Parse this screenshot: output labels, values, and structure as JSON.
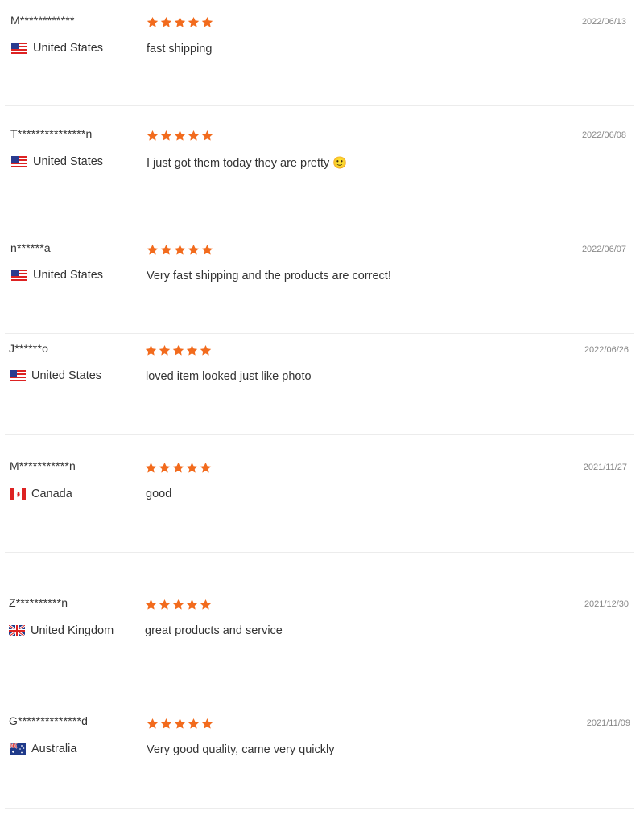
{
  "reviews": [
    {
      "name": "M************",
      "country": "United States",
      "flag": "us",
      "rating": 5,
      "text": "fast shipping",
      "date": "2022/06/13"
    },
    {
      "name": "T***************n",
      "country": "United States",
      "flag": "us",
      "rating": 5,
      "text": "I just got them today they are pretty 🙂",
      "date": "2022/06/08"
    },
    {
      "name": "n******a",
      "country": "United States",
      "flag": "us",
      "rating": 5,
      "text": "Very fast shipping and the products are correct!",
      "date": "2022/06/07"
    },
    {
      "name": "J******o",
      "country": "United States",
      "flag": "us",
      "rating": 5,
      "text": "loved item looked just like photo",
      "date": "2022/06/26"
    },
    {
      "name": "M***********n",
      "country": "Canada",
      "flag": "ca",
      "rating": 5,
      "text": "good",
      "date": "2021/11/27"
    },
    {
      "name": "Z**********n",
      "country": "United Kingdom",
      "flag": "gb",
      "rating": 5,
      "text": "great products and service",
      "date": "2021/12/30"
    },
    {
      "name": "G**************d",
      "country": "Australia",
      "flag": "au",
      "rating": 5,
      "text": "Very good quality, came very quickly",
      "date": "2021/11/09"
    }
  ],
  "colors": {
    "star": "#f26b1d",
    "divider": "#ececec",
    "date": "#888888",
    "text": "#333333"
  }
}
